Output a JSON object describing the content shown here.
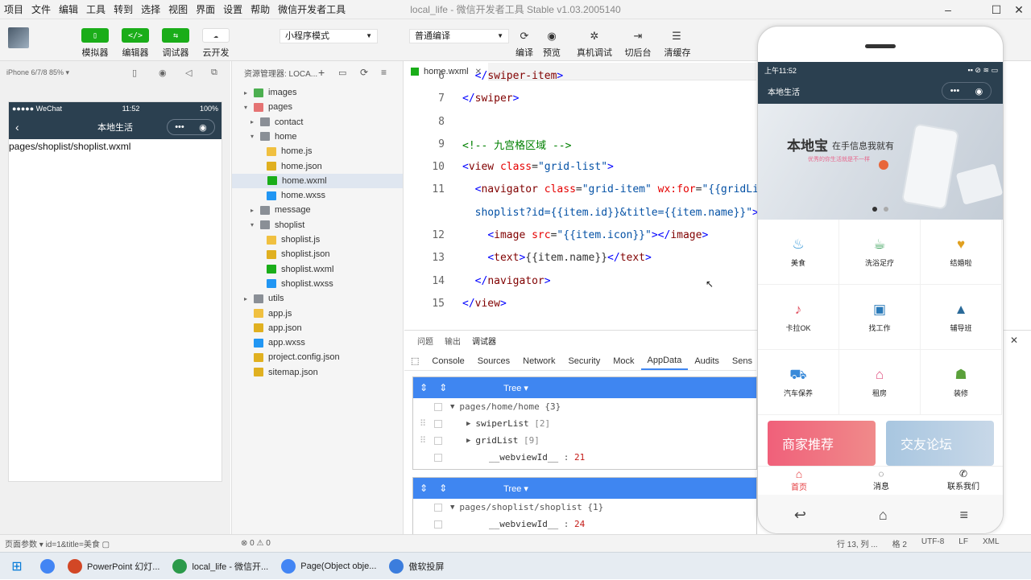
{
  "menu": [
    "项目",
    "文件",
    "编辑",
    "工具",
    "转到",
    "选择",
    "视图",
    "界面",
    "设置",
    "帮助",
    "微信开发者工具"
  ],
  "window_title": "local_life - 微信开发者工具 Stable v1.03.2005140",
  "toolbar": {
    "simulator": "模拟器",
    "editor": "编辑器",
    "debugger": "调试器",
    "cloud": "云开发",
    "mode_select": "小程序模式",
    "compile_select": "普通编译",
    "compile": "编译",
    "preview": "预览",
    "real_debug": "真机调试",
    "background": "切后台",
    "clear_cache": "清缓存"
  },
  "simulator": {
    "device": "iPhone 6/7/8 85% ▾",
    "status_left": "●●●●● WeChat",
    "status_time": "11:52",
    "status_right": "100%",
    "nav_title": "本地生活",
    "content": "pages/shoplist/shoplist.wxml"
  },
  "explorer": {
    "header": "资源管理器: LOCA...",
    "items": [
      {
        "label": "images",
        "indent": 1,
        "type": "folder-img",
        "arrow": "▸"
      },
      {
        "label": "pages",
        "indent": 1,
        "type": "folder-pages",
        "arrow": "▾"
      },
      {
        "label": "contact",
        "indent": 2,
        "type": "folder",
        "arrow": "▸"
      },
      {
        "label": "home",
        "indent": 2,
        "type": "folder",
        "arrow": "▾"
      },
      {
        "label": "home.js",
        "indent": 3,
        "type": "js",
        "arrow": ""
      },
      {
        "label": "home.json",
        "indent": 3,
        "type": "json",
        "arrow": ""
      },
      {
        "label": "home.wxml",
        "indent": 3,
        "type": "wxml",
        "arrow": "",
        "selected": true
      },
      {
        "label": "home.wxss",
        "indent": 3,
        "type": "wxss",
        "arrow": ""
      },
      {
        "label": "message",
        "indent": 2,
        "type": "folder",
        "arrow": "▸"
      },
      {
        "label": "shoplist",
        "indent": 2,
        "type": "folder",
        "arrow": "▾"
      },
      {
        "label": "shoplist.js",
        "indent": 3,
        "type": "js",
        "arrow": ""
      },
      {
        "label": "shoplist.json",
        "indent": 3,
        "type": "json",
        "arrow": ""
      },
      {
        "label": "shoplist.wxml",
        "indent": 3,
        "type": "wxml",
        "arrow": ""
      },
      {
        "label": "shoplist.wxss",
        "indent": 3,
        "type": "wxss",
        "arrow": ""
      },
      {
        "label": "utils",
        "indent": 1,
        "type": "folder",
        "arrow": "▸"
      },
      {
        "label": "app.js",
        "indent": 1,
        "type": "js",
        "arrow": ""
      },
      {
        "label": "app.json",
        "indent": 1,
        "type": "json",
        "arrow": ""
      },
      {
        "label": "app.wxss",
        "indent": 1,
        "type": "wxss",
        "arrow": ""
      },
      {
        "label": "project.config.json",
        "indent": 1,
        "type": "json",
        "arrow": ""
      },
      {
        "label": "sitemap.json",
        "indent": 1,
        "type": "json",
        "arrow": ""
      }
    ]
  },
  "editor": {
    "tab": "home.wxml",
    "lines": [
      {
        "n": "6",
        "parts": [
          [
            "pl",
            "  "
          ],
          [
            "bk",
            "</"
          ],
          [
            "tg",
            "swiper-item"
          ],
          [
            "bk",
            ">"
          ]
        ]
      },
      {
        "n": "7",
        "parts": [
          [
            "bk",
            "</"
          ],
          [
            "tg",
            "swiper"
          ],
          [
            "bk",
            ">"
          ]
        ]
      },
      {
        "n": "8",
        "parts": []
      },
      {
        "n": "9",
        "parts": [
          [
            "cm",
            "<!-- 九宫格区域 -->"
          ]
        ]
      },
      {
        "n": "10",
        "parts": [
          [
            "bk",
            "<"
          ],
          [
            "tg",
            "view"
          ],
          [
            "pl",
            " "
          ],
          [
            "at",
            "class"
          ],
          [
            "pl",
            "="
          ],
          [
            "st",
            "\"grid-list\""
          ],
          [
            "bk",
            ">"
          ]
        ]
      },
      {
        "n": "11",
        "parts": [
          [
            "pl",
            "  "
          ],
          [
            "bk",
            "<"
          ],
          [
            "tg",
            "navigator"
          ],
          [
            "pl",
            " "
          ],
          [
            "at",
            "class"
          ],
          [
            "pl",
            "="
          ],
          [
            "st",
            "\"grid-item\""
          ],
          [
            "pl",
            " "
          ],
          [
            "at",
            "wx:for"
          ],
          [
            "pl",
            "="
          ],
          [
            "st",
            "\"{{gridList"
          ]
        ]
      },
      {
        "n": "",
        "parts": [
          [
            "pl",
            "  "
          ],
          [
            "st",
            "shoplist?id={{item.id}}&title={{item.name}}\""
          ],
          [
            "bk",
            ">"
          ]
        ]
      },
      {
        "n": "12",
        "parts": [
          [
            "pl",
            "    "
          ],
          [
            "bk",
            "<"
          ],
          [
            "tg",
            "image"
          ],
          [
            "pl",
            " "
          ],
          [
            "at",
            "src"
          ],
          [
            "pl",
            "="
          ],
          [
            "st",
            "\"{{item.icon}}\""
          ],
          [
            "bk",
            "></"
          ],
          [
            "tg",
            "image"
          ],
          [
            "bk",
            ">"
          ]
        ]
      },
      {
        "n": "13",
        "parts": [
          [
            "pl",
            "    "
          ],
          [
            "bk",
            "<"
          ],
          [
            "tg",
            "text"
          ],
          [
            "bk",
            ">"
          ],
          [
            "pl",
            "{{item.name}}"
          ],
          [
            "bk",
            "</"
          ],
          [
            "tg",
            "text"
          ],
          [
            "bk",
            ">"
          ]
        ]
      },
      {
        "n": "14",
        "parts": [
          [
            "pl",
            "  "
          ],
          [
            "bk",
            "</"
          ],
          [
            "tg",
            "navigator"
          ],
          [
            "bk",
            ">"
          ]
        ]
      },
      {
        "n": "15",
        "parts": [
          [
            "bk",
            "</"
          ],
          [
            "tg",
            "view"
          ],
          [
            "bk",
            ">"
          ]
        ]
      }
    ]
  },
  "devtools": {
    "top_tabs": [
      "问题",
      "输出",
      "调试器"
    ],
    "nav": [
      "Console",
      "Sources",
      "Network",
      "Security",
      "Mock",
      "AppData",
      "Audits",
      "Sens"
    ],
    "tree_label": "Tree ▾",
    "panel1": {
      "path": "pages/home/home",
      "path_count": "{3}",
      "rows": [
        {
          "key": "swiperList",
          "val": "[2]"
        },
        {
          "key": "gridList",
          "val": "[9]"
        }
      ],
      "webview_key": "__webviewId__",
      "webview_val": "21"
    },
    "panel2": {
      "path": "pages/shoplist/shoplist",
      "path_count": "{1}",
      "webview_key": "__webviewId__",
      "webview_val": "24"
    }
  },
  "mobile": {
    "time": "上午11:52",
    "title": "本地生活",
    "banner_title": "本地宝",
    "banner_sub": "在手信息我就有",
    "banner_sub2": "优秀的你生活就是不一样",
    "grid": [
      "美食",
      "洗浴足疗",
      "结婚啦",
      "卡拉OK",
      "找工作",
      "辅导班",
      "汽车保养",
      "租房",
      "装修"
    ],
    "grid_icons": [
      "♨",
      "☕",
      "♥",
      "♪",
      "▣",
      "▲",
      "⛟",
      "⌂",
      "☗"
    ],
    "promo_left": "商家推荐",
    "promo_right": "交友论坛",
    "tabs": [
      "首页",
      "消息",
      "联系我们"
    ],
    "tab_icons": [
      "⌂",
      "◌",
      "✆"
    ]
  },
  "status": {
    "left": "页面参数 ▾   id=1&title=美食 ▢",
    "middle": "⊗ 0 ⚠ 0",
    "right_items": [
      "行 13, 列 ...",
      "格 2",
      "UTF-8",
      "LF",
      "XML"
    ]
  },
  "taskbar": [
    {
      "label": "PowerPoint 幻灯...",
      "color": "#d24726"
    },
    {
      "label": "local_life - 微信开...",
      "color": "#2b9a4a"
    },
    {
      "label": "Page(Object obje...",
      "color": "#4285f4"
    },
    {
      "label": "傲软投屏",
      "color": "#3b7ddd"
    }
  ],
  "colors": {
    "wechat_green": "#1aad19",
    "nav_dark": "#2b4050",
    "tree_blue": "#3f86f1",
    "home_red": "#e4393c"
  }
}
